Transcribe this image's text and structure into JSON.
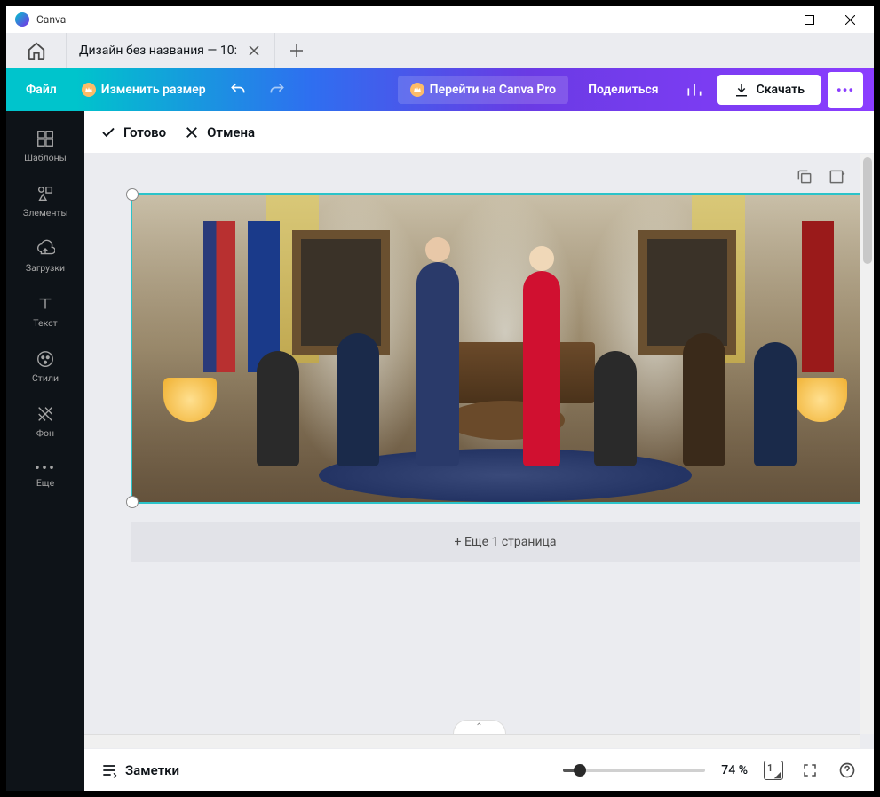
{
  "titlebar": {
    "app_name": "Canva"
  },
  "tabs": {
    "active_title": "Дизайн без названия — 10:"
  },
  "toolbar": {
    "file": "Файл",
    "resize": "Изменить размер",
    "pro": "Перейти на Canva Pro",
    "share": "Поделиться",
    "download": "Скачать"
  },
  "crop": {
    "done": "Готово",
    "cancel": "Отмена"
  },
  "sidebar": {
    "items": [
      {
        "label": "Шаблоны"
      },
      {
        "label": "Элементы"
      },
      {
        "label": "Загрузки"
      },
      {
        "label": "Текст"
      },
      {
        "label": "Стили"
      },
      {
        "label": "Фон"
      },
      {
        "label": "Еще"
      }
    ]
  },
  "canvas": {
    "add_page": "+ Еще 1 страница"
  },
  "footer": {
    "notes": "Заметки",
    "zoom": "74 %",
    "page_indicator": "1"
  }
}
